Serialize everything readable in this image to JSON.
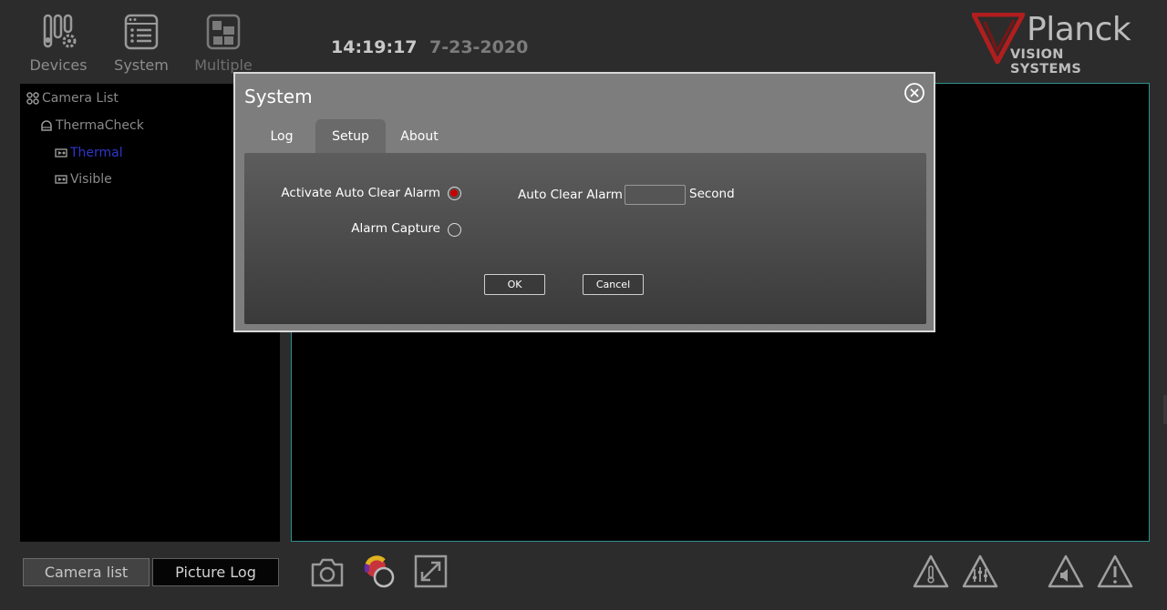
{
  "toolbar": {
    "devices_label": "Devices",
    "system_label": "System",
    "multiple_label": "Multiple",
    "time": "14:19:17",
    "date": "7-23-2020"
  },
  "logo": {
    "brand": "Planck",
    "tagline": "VISION SYSTEMS",
    "accent_color": "#b01e1e"
  },
  "tree": {
    "root": "Camera List",
    "group": "ThermaCheck",
    "items": [
      "Thermal",
      "Visible"
    ]
  },
  "bottom": {
    "camera_list_label": "Camera list",
    "picture_log_label": "Picture Log",
    "icons": [
      "camera-icon",
      "color-palette-icon",
      "fullscreen-icon",
      "temperature-alarm-icon",
      "settings-alarm-icon",
      "audio-alarm-icon",
      "warning-icon"
    ]
  },
  "dialog": {
    "title": "System",
    "tabs": [
      "Log",
      "Setup",
      "About"
    ],
    "active_tab": "Setup",
    "activate_auto_clear_label": "Activate Auto Clear Alarm",
    "activate_auto_clear_checked": true,
    "alarm_capture_label": "Alarm Capture",
    "alarm_capture_checked": false,
    "auto_clear_label": "Auto Clear Alarm",
    "auto_clear_value": "",
    "seconds_unit": "Second",
    "ok_label": "OK",
    "cancel_label": "Cancel"
  }
}
